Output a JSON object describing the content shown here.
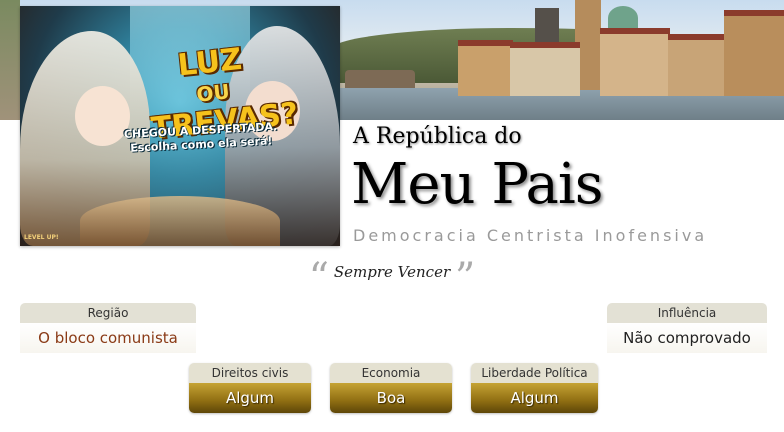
{
  "ad": {
    "title_line1": "LUZ",
    "title_line2": "OU",
    "title_line3": "TREVAS?",
    "tagline_line1": "CHEGOU A DESPERTADA.",
    "tagline_line2": "Escolha como ela será!",
    "logo": "LEVEL UP!"
  },
  "nation": {
    "pretitle": "A República do",
    "name": "Meu Pais",
    "category": "Democracia Centrista Inofensiva",
    "motto": "Sempre Vencer",
    "quote_open": "“",
    "quote_close": "”"
  },
  "region": {
    "label": "Região",
    "value": "O bloco comunista"
  },
  "influence": {
    "label": "Influência",
    "value": "Não comprovado"
  },
  "stats": [
    {
      "label": "Direitos civis",
      "value": "Algum"
    },
    {
      "label": "Economia",
      "value": "Boa"
    },
    {
      "label": "Liberdade Política",
      "value": "Algum"
    }
  ],
  "colors": {
    "region_link": "#8a3a16",
    "stat_gold": "#8f6e12",
    "header_beige": "#e3e1d5"
  }
}
